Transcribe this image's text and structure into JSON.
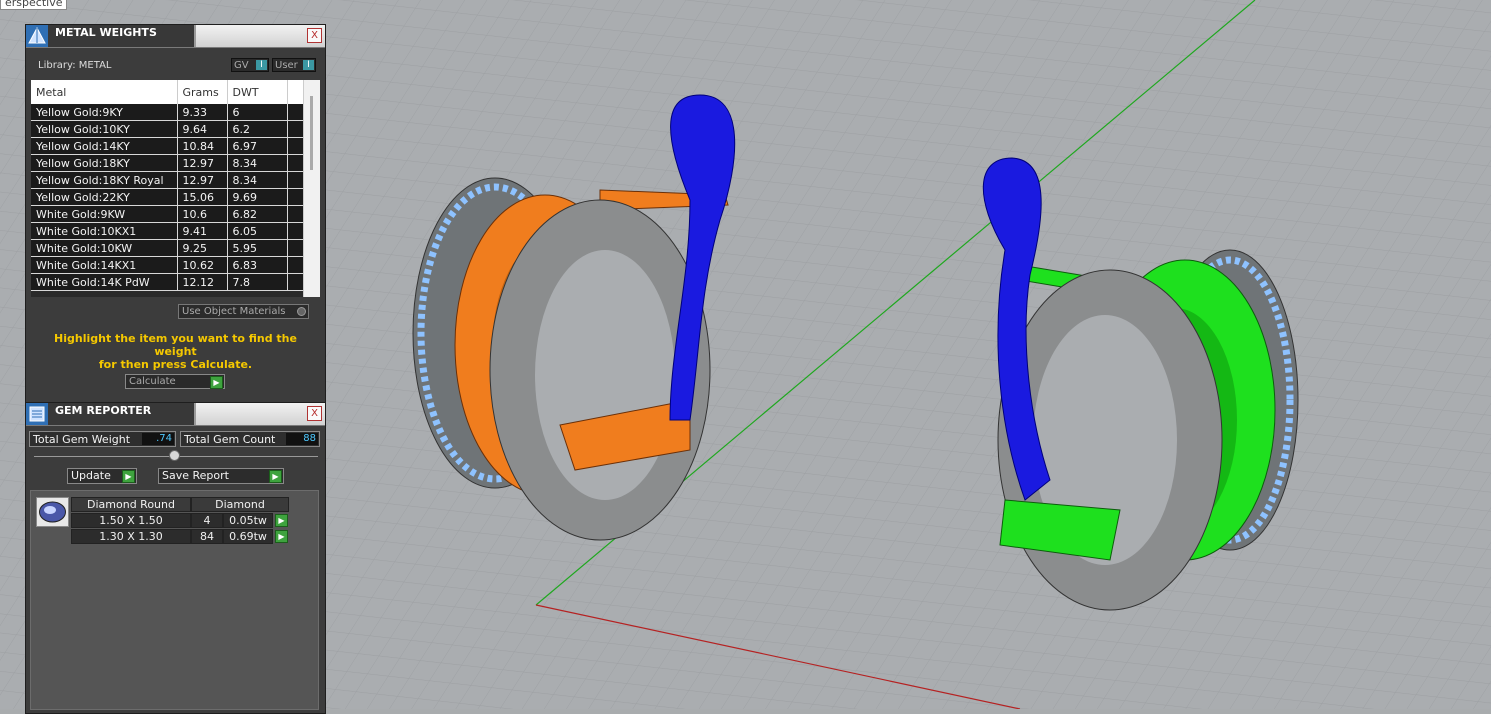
{
  "viewport": {
    "label": "erspective"
  },
  "metal_weights": {
    "title": "METAL WEIGHTS",
    "close": "X",
    "library_label": "Library: METAL",
    "toggle_gv": "GV",
    "toggle_user": "User",
    "toggle_glyph": "I",
    "columns": [
      "Metal",
      "Grams",
      "DWT"
    ],
    "rows": [
      [
        "Yellow Gold:9KY",
        "9.33",
        "6"
      ],
      [
        "Yellow Gold:10KY",
        "9.64",
        "6.2"
      ],
      [
        "Yellow Gold:14KY",
        "10.84",
        "6.97"
      ],
      [
        "Yellow Gold:18KY",
        "12.97",
        "8.34"
      ],
      [
        "Yellow Gold:18KY Royal",
        "12.97",
        "8.34"
      ],
      [
        "Yellow Gold:22KY",
        "15.06",
        "9.69"
      ],
      [
        "White Gold:9KW",
        "10.6",
        "6.82"
      ],
      [
        "White Gold:10KX1",
        "9.41",
        "6.05"
      ],
      [
        "White Gold:10KW",
        "9.25",
        "5.95"
      ],
      [
        "White Gold:14KX1",
        "10.62",
        "6.83"
      ],
      [
        "White Gold:14K PdW",
        "12.12",
        "7.8"
      ]
    ],
    "use_object_materials": "Use Object Materials",
    "hint_line1": "Highlight the item you want to find the weight",
    "hint_line2": "for then press Calculate.",
    "calculate_label": "Calculate"
  },
  "gem_reporter": {
    "title": "GEM REPORTER",
    "close": "X",
    "total_weight_label": "Total Gem Weight",
    "total_weight_value": ".74",
    "total_count_label": "Total Gem Count",
    "total_count_value": "88",
    "update_label": "Update",
    "save_label": "Save Report",
    "arrow": "▶",
    "gem_type": "Diamond Round",
    "gem_material": "Diamond",
    "gem_rows": [
      {
        "size": "1.50 X 1.50",
        "count": "4",
        "weight": "0.05tw"
      },
      {
        "size": "1.30 X 1.30",
        "count": "84",
        "weight": "0.69tw"
      }
    ]
  },
  "colors": {
    "panel_bg": "#3c3c3c",
    "hint_text": "#f5c800",
    "accent_green": "#3ea33e",
    "value_cyan": "#4ec9ff",
    "viewport_bg": "#aaadb0",
    "earring_left_band": "#f07d1e",
    "earring_right_band": "#1ee01e",
    "hook": "#1a1ae0"
  }
}
